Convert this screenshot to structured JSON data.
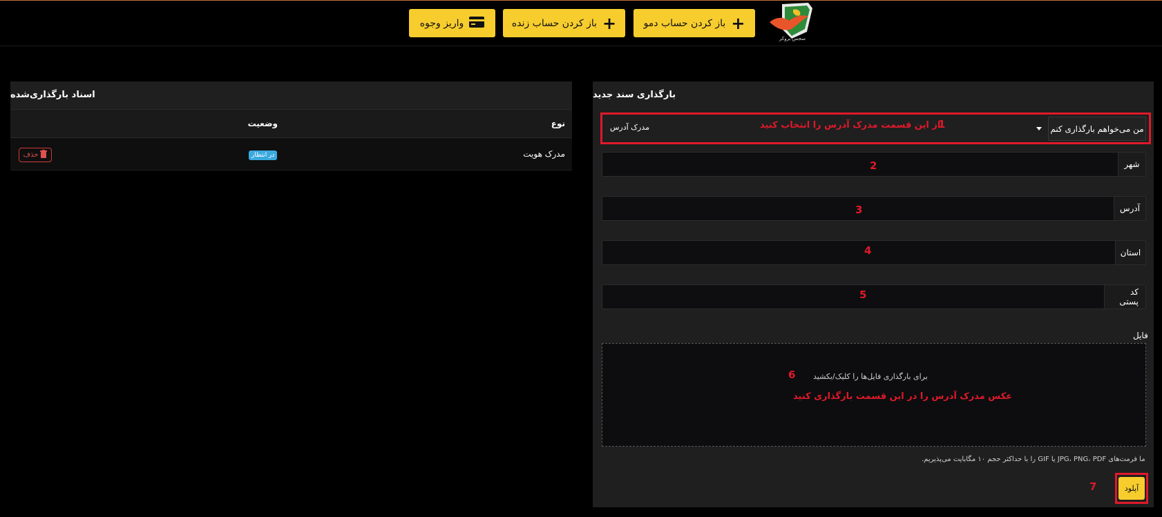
{
  "header": {
    "logo_text": "سجس بروکر",
    "buttons": [
      {
        "label": "باز کردن حساب دمو",
        "icon": "plus-icon"
      },
      {
        "label": "باز کردن حساب زنده",
        "icon": "plus-icon"
      },
      {
        "label": "واریز وجوه",
        "icon": "credit-card-icon"
      }
    ]
  },
  "upload_panel": {
    "title": "بارگذاری سند جدید",
    "doc_type": {
      "label": "من می‌خواهم بارگذاری کنم",
      "selected": "مدرک آدرس"
    },
    "fields": [
      {
        "label": "شهر",
        "value": ""
      },
      {
        "label": "آدرس",
        "value": ""
      },
      {
        "label": "استان",
        "value": ""
      },
      {
        "label": "کد پستی",
        "value": ""
      }
    ],
    "file_label": "فایل",
    "dropzone_text": "برای بارگذاری فایل‌ها را کلیک/بکشید",
    "formats_note": "ما فرمت‌های JPG، PNG، PDF یا GIF را با حداکثر حجم ۱۰ مگابایت می‌پذیریم.",
    "upload_button": "آپلود"
  },
  "annotations": {
    "step1_text": "از این قسمت مدرک آدرس را انتخاب کنید",
    "step6_text": "عکس مدرک آدرس را در این قسمت بارگذاری کنید",
    "numbers": [
      "1",
      "2",
      "3",
      "4",
      "5",
      "6",
      "7"
    ],
    "color": "#e0192a"
  },
  "uploaded_panel": {
    "title": "اسناد بارگذاری‌شده",
    "columns": [
      "نوع",
      "وضعیت"
    ],
    "rows": [
      {
        "type": "مدرک هویت",
        "status": "در انتظار",
        "action": "حذف"
      }
    ]
  },
  "colors": {
    "accent": "#f7cd2e",
    "badge": "#3aa9e0",
    "delete": "#d23a3a"
  }
}
